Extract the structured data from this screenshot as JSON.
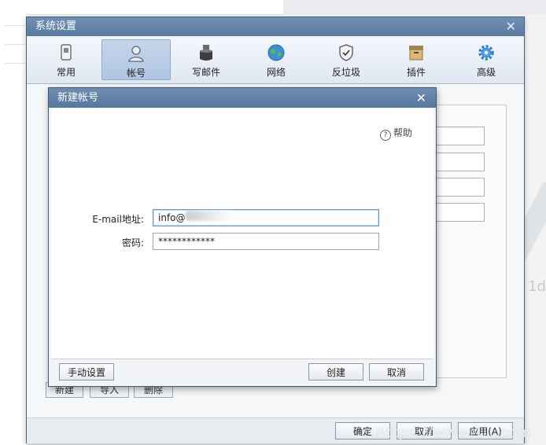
{
  "settings_window": {
    "title": "系统设置",
    "close_glyph": "✕",
    "toolbar": [
      {
        "label": "常用",
        "icon": "general-icon"
      },
      {
        "label": "帐号",
        "icon": "account-icon",
        "active": true
      },
      {
        "label": "写邮件",
        "icon": "compose-icon"
      },
      {
        "label": "网络",
        "icon": "network-icon"
      },
      {
        "label": "反垃圾",
        "icon": "antispam-icon"
      },
      {
        "label": "插件",
        "icon": "plugin-icon"
      },
      {
        "label": "高级",
        "icon": "advanced-icon"
      }
    ],
    "account_buttons": [
      "新建",
      "导入",
      "删除"
    ],
    "footer_buttons": [
      "确定",
      "取消",
      "应用(A)"
    ]
  },
  "new_account_dialog": {
    "title": "新建帐号",
    "close_glyph": "✕",
    "help_label": "帮助",
    "help_glyph": "?",
    "email_label": "E-mail地址:",
    "email_value": "info@",
    "password_label": "密码:",
    "password_value": "************",
    "manual_setup_button": "手动设置",
    "create_button": "创建",
    "cancel_button": "取消"
  },
  "watermark": "https://www.1...com",
  "background_text": "1d",
  "colors": {
    "title_bar": "#5b7ca2",
    "toolbar_active": "#aec5e1",
    "dialog_border": "#3f5878"
  }
}
